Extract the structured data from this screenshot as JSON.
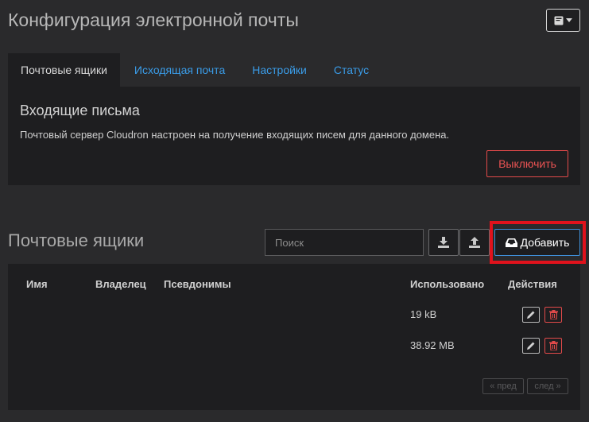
{
  "header": {
    "title": "Конфигурация электронной почты",
    "menu_icon": "book-dropdown-icon"
  },
  "tabs": [
    {
      "label": "Почтовые ящики",
      "active": true
    },
    {
      "label": "Исходящая почта",
      "active": false
    },
    {
      "label": "Настройки",
      "active": false
    },
    {
      "label": "Статус",
      "active": false
    }
  ],
  "incoming": {
    "title": "Входящие письма",
    "description": "Почтовый сервер Cloudron настроен на получение входящих писем для данного домена.",
    "disable_label": "Выключить"
  },
  "mailboxes": {
    "title": "Почтовые ящики",
    "search_placeholder": "Поиск",
    "add_label": "Добавить",
    "columns": {
      "name": "Имя",
      "owner": "Владелец",
      "aliases": "Псевдонимы",
      "used": "Использовано",
      "actions": "Действия"
    },
    "rows": [
      {
        "name": "",
        "owner": "",
        "aliases": "",
        "used": "19 kB"
      },
      {
        "name": "",
        "owner": "",
        "aliases": "",
        "used": "38.92 MB"
      }
    ],
    "pager": {
      "prev": "пред",
      "next": "след"
    }
  },
  "colors": {
    "accent": "#3a9ce8",
    "danger": "#e24a4a",
    "highlight": "#e0121c",
    "panel": "#1e1e20",
    "background": "#2a2a2c"
  }
}
